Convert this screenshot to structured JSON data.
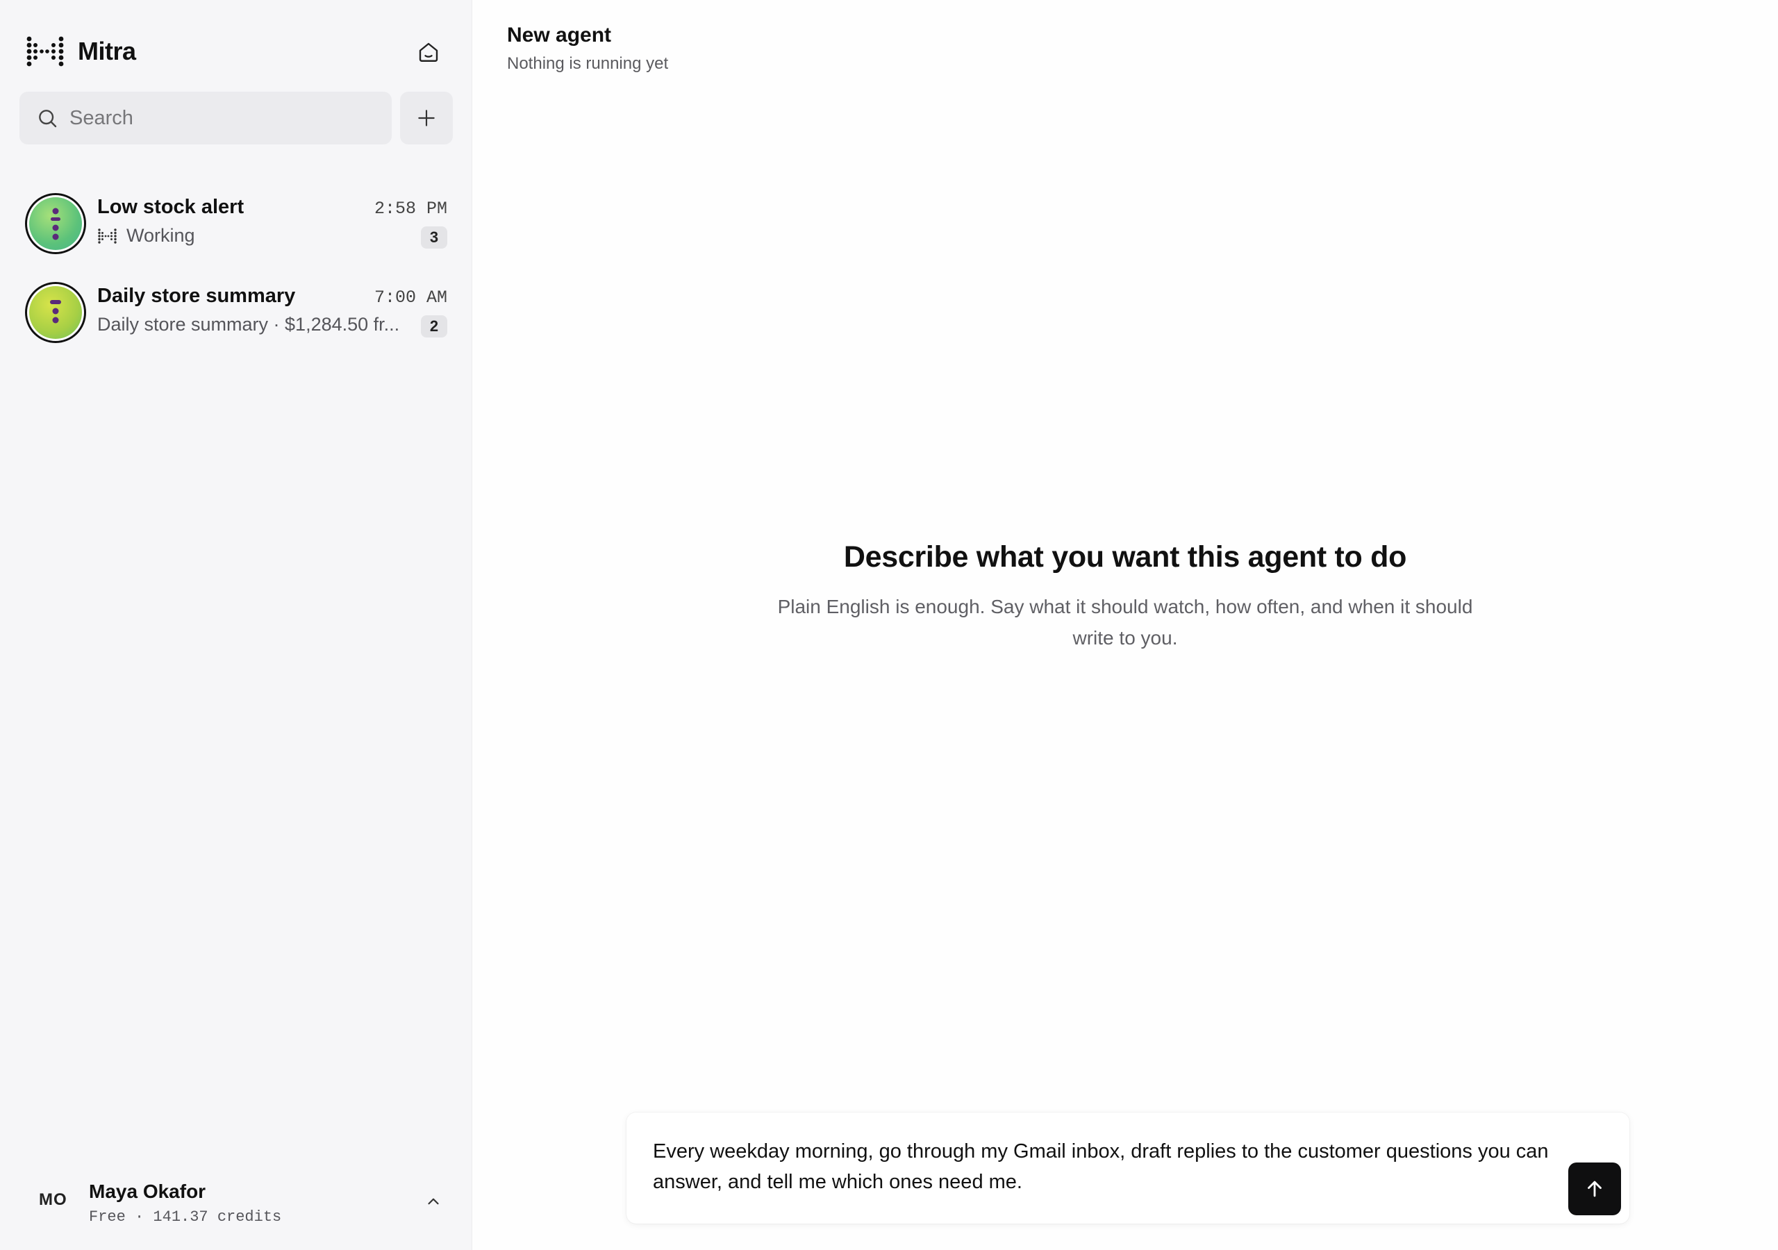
{
  "app": {
    "name": "Mitra"
  },
  "search": {
    "placeholder": "Search"
  },
  "agents": [
    {
      "title": "Low stock alert",
      "subtitle": "Working",
      "time": "2:58 PM",
      "count": "3",
      "accent": "#7cc66e"
    },
    {
      "title": "Daily store summary",
      "subtitle": "Daily store summary · $1,284.50 fr...",
      "time": "7:00 AM",
      "count": "2",
      "accent": "#b9d94a"
    }
  ],
  "user": {
    "initials": "MO",
    "name": "Maya Okafor",
    "plan": "Free · 141.37 credits"
  },
  "main": {
    "title": "New agent",
    "subtitle": "Nothing is running yet",
    "empty_heading": "Describe what you want this agent to do",
    "empty_body": "Plain English is enough. Say what it should watch, how often, and when it should write to you."
  },
  "composer": {
    "value": "Every weekday morning, go through my Gmail inbox, draft replies to the customer questions you can answer, and tell me which ones need me."
  },
  "icons": {
    "brand": "mitra-logo-icon",
    "home": "home-icon",
    "search": "search-icon",
    "add": "plus-icon",
    "working": "working-dots-icon",
    "chevron": "chevron-up-icon",
    "send": "arrow-up-icon"
  },
  "colors": {
    "sidebar_bg": "#f6f6f8",
    "send_bg": "#0f0f10",
    "avatar_face": "#5a2a7a"
  }
}
